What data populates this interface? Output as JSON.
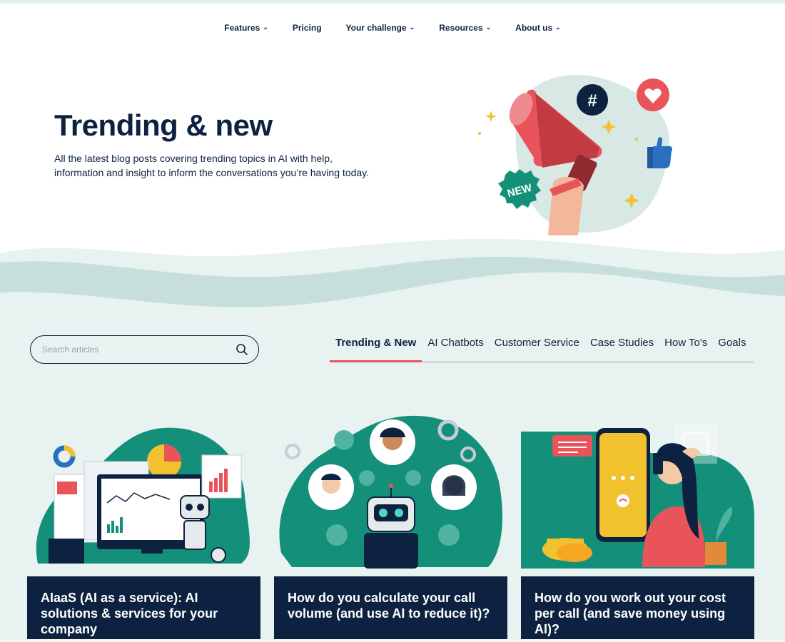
{
  "nav": {
    "items": [
      {
        "label": "Features",
        "has_dropdown": true
      },
      {
        "label": "Pricing",
        "has_dropdown": false
      },
      {
        "label": "Your challenge",
        "has_dropdown": true
      },
      {
        "label": "Resources",
        "has_dropdown": true
      },
      {
        "label": "About us",
        "has_dropdown": true
      }
    ],
    "chevron": "⌄"
  },
  "hero": {
    "title": "Trending & new",
    "description": "All the latest blog posts covering trending topics in AI with help, information and insight to inform the conversations you’re having today.",
    "badge_new": "NEW",
    "hashtag": "#"
  },
  "search": {
    "placeholder": "Search articles",
    "value": ""
  },
  "tabs": [
    {
      "label": "Trending & New",
      "active": true
    },
    {
      "label": "AI Chatbots",
      "active": false
    },
    {
      "label": "Customer Service",
      "active": false
    },
    {
      "label": "Case Studies",
      "active": false
    },
    {
      "label": "How To's",
      "active": false
    },
    {
      "label": "Goals",
      "active": false
    }
  ],
  "cards": [
    {
      "title": "AIaaS (AI as a service): AI solutions & services for your company"
    },
    {
      "title": "How do you calculate your call volume (and use AI to reduce it)?"
    },
    {
      "title": "How do you work out your cost per call (and save money using AI)?"
    }
  ],
  "colors": {
    "navy": "#0d2240",
    "teal": "#14907a",
    "coral": "#e8545a",
    "mint": "#e8f2f0",
    "yellow": "#f2c12e"
  }
}
